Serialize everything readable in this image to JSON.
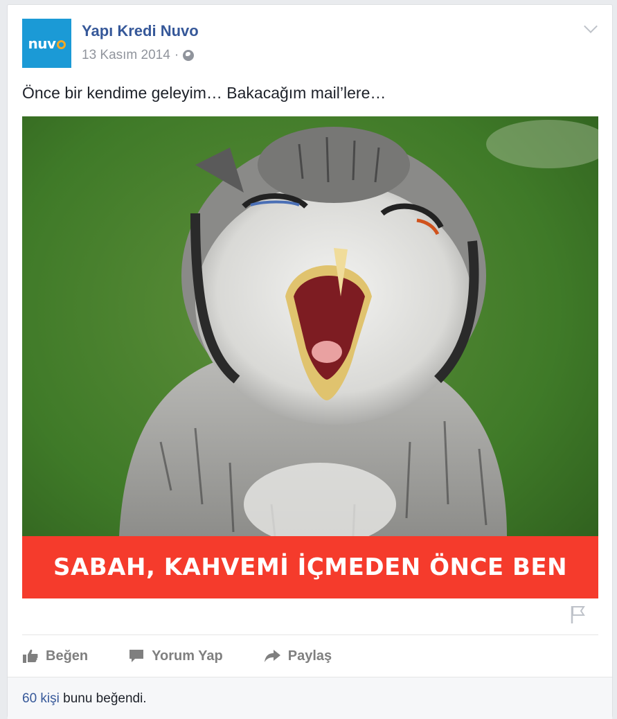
{
  "post": {
    "page_name": "Yapı Kredi Nuvo",
    "avatar_logo": "nuvo",
    "date": "13 Kasım 2014",
    "separator": "·",
    "text": "Önce bir kendime geleyim… Bakacağım mail’lere…"
  },
  "image": {
    "banner_text": "SABAH, KAHVEMİ İÇMEDEN ÖNCE BEN"
  },
  "actions": {
    "like_label": "Beğen",
    "comment_label": "Yorum Yap",
    "share_label": "Paylaş"
  },
  "footer": {
    "likes_link": "60 kişi",
    "likes_text": "bunu beğendi."
  },
  "icons": [
    "globe-icon",
    "chevron-down-icon",
    "flag-icon",
    "like-icon",
    "comment-icon",
    "share-icon"
  ],
  "colors": {
    "link": "#365899",
    "muted": "#90949c",
    "banner": "#f53b2c",
    "avatar_bg": "#1b9ad6"
  }
}
